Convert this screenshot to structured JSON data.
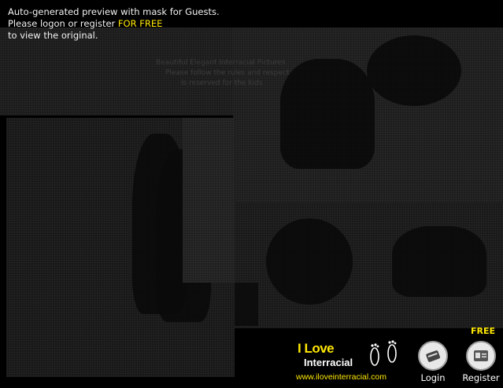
{
  "notice": {
    "line1": "Auto-generated preview with mask for Guests.",
    "line2_prefix": "Please logon or register ",
    "line2_highlight": "FOR FREE",
    "line3": "to view the original."
  },
  "image_caption": {
    "lines": [
      "Beautiful Elegant Interracial Pictures",
      "Please follow the rules and respect",
      "is reserved for the kids"
    ]
  },
  "logo": {
    "line1": "I Love",
    "line2": "Interracial",
    "url": "www.iloveinterracial.com"
  },
  "buttons": {
    "free_badge": "FREE",
    "login": "Login",
    "register": "Register"
  },
  "colors": {
    "accent": "#ffe800",
    "background": "#000000",
    "text": "#f2f2f2"
  },
  "icons": {
    "login": "login-card-icon",
    "register": "register-id-icon",
    "feet": "footprints-icon"
  }
}
